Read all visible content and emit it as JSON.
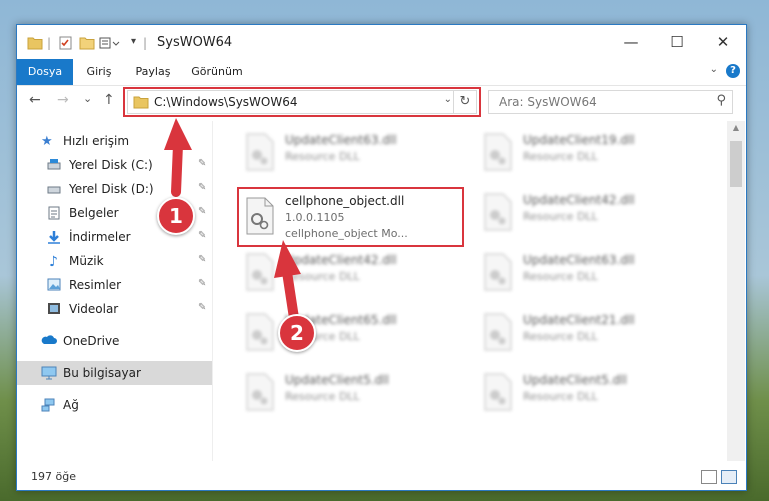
{
  "window": {
    "title": "SysWOW64",
    "controls": {
      "minimize": "—",
      "maximize": "☐",
      "close": "✕"
    }
  },
  "ribbon": {
    "tabs": [
      {
        "label": "Dosya",
        "active": true
      },
      {
        "label": "Giriş"
      },
      {
        "label": "Paylaş"
      },
      {
        "label": "Görünüm"
      }
    ],
    "help": "?"
  },
  "navigation": {
    "back": "←",
    "forward": "→",
    "recent": "⌄",
    "up": "↑",
    "address": "C:\\Windows\\SysWOW64",
    "refresh": "↻",
    "search_placeholder": "Ara: SysWOW64"
  },
  "sidebar": {
    "items": [
      {
        "label": "Hızlı erişim",
        "icon": "star-icon"
      },
      {
        "label": "Yerel Disk (C:)",
        "icon": "drive-icon",
        "pinned": true
      },
      {
        "label": "Yerel Disk (D:)",
        "icon": "drive-icon",
        "pinned": true
      },
      {
        "label": "Belgeler",
        "icon": "documents-icon",
        "pinned": true
      },
      {
        "label": "İndirmeler",
        "icon": "download-icon",
        "pinned": true
      },
      {
        "label": "Müzik",
        "icon": "music-icon",
        "pinned": true
      },
      {
        "label": "Resimler",
        "icon": "pictures-icon",
        "pinned": true
      },
      {
        "label": "Videolar",
        "icon": "videos-icon",
        "pinned": true
      },
      {
        "label": "OneDrive",
        "icon": "cloud-icon"
      },
      {
        "label": "Bu bilgisayar",
        "icon": "computer-icon",
        "selected": true
      },
      {
        "label": "Ağ",
        "icon": "network-icon"
      }
    ],
    "pin_glyph": "📌"
  },
  "files": {
    "col1": [
      {
        "name": "UpdateClient63.dll",
        "type": "Resource DLL"
      },
      {
        "name": "cellphone_object.dll",
        "version": "1.0.0.1105",
        "desc": "cellphone_object Mo...",
        "highlighted": true
      },
      {
        "name": "UpdateClient42.dll",
        "type": "Resource DLL"
      },
      {
        "name": "UpdateClient65.dll",
        "type": "Resource DLL"
      },
      {
        "name": "UpdateClient5.dll",
        "type": "Resource DLL"
      }
    ],
    "col2": [
      {
        "name": "UpdateClient19.dll",
        "type": "Resource DLL"
      },
      {
        "name": "UpdateClient42.dll",
        "type": "Resource DLL"
      },
      {
        "name": "UpdateClient63.dll",
        "type": "Resource DLL"
      },
      {
        "name": "UpdateClient21.dll",
        "type": "Resource DLL"
      },
      {
        "name": "UpdateClient5.dll",
        "type": "Resource DLL"
      }
    ]
  },
  "status": {
    "count": "197 öğe"
  },
  "annotations": {
    "step1": "1",
    "step2": "2"
  },
  "colors": {
    "accent": "#1979ca",
    "highlight": "#d9353d"
  }
}
